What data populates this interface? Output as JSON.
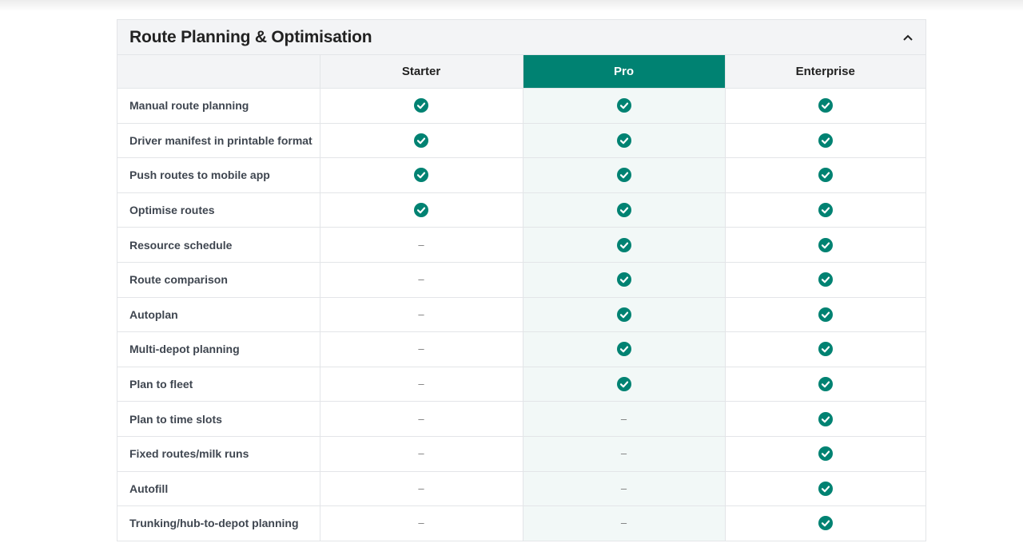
{
  "section": {
    "title": "Route Planning & Optimisation",
    "collapse_icon": "chevron-up-icon"
  },
  "colors": {
    "accent": "#008272",
    "pro_cell_bg": "#f2f8f7",
    "header_bg": "#f3f4f6"
  },
  "plans": [
    "Starter",
    "Pro",
    "Enterprise"
  ],
  "rows": [
    {
      "feature": "Manual route planning",
      "values": [
        true,
        true,
        true
      ]
    },
    {
      "feature": "Driver manifest in printable format",
      "values": [
        true,
        true,
        true
      ]
    },
    {
      "feature": "Push routes to mobile app",
      "values": [
        true,
        true,
        true
      ]
    },
    {
      "feature": "Optimise routes",
      "values": [
        true,
        true,
        true
      ]
    },
    {
      "feature": "Resource schedule",
      "values": [
        false,
        true,
        true
      ]
    },
    {
      "feature": "Route comparison",
      "values": [
        false,
        true,
        true
      ]
    },
    {
      "feature": "Autoplan",
      "values": [
        false,
        true,
        true
      ]
    },
    {
      "feature": "Multi-depot planning",
      "values": [
        false,
        true,
        true
      ]
    },
    {
      "feature": "Plan to fleet",
      "values": [
        false,
        true,
        true
      ]
    },
    {
      "feature": "Plan to time slots",
      "values": [
        false,
        false,
        true
      ]
    },
    {
      "feature": "Fixed routes/milk runs",
      "values": [
        false,
        false,
        true
      ]
    },
    {
      "feature": "Autofill",
      "values": [
        false,
        false,
        true
      ]
    },
    {
      "feature": "Trunking/hub-to-depot planning",
      "values": [
        false,
        false,
        true
      ]
    }
  ],
  "unavailable_mark": "–"
}
